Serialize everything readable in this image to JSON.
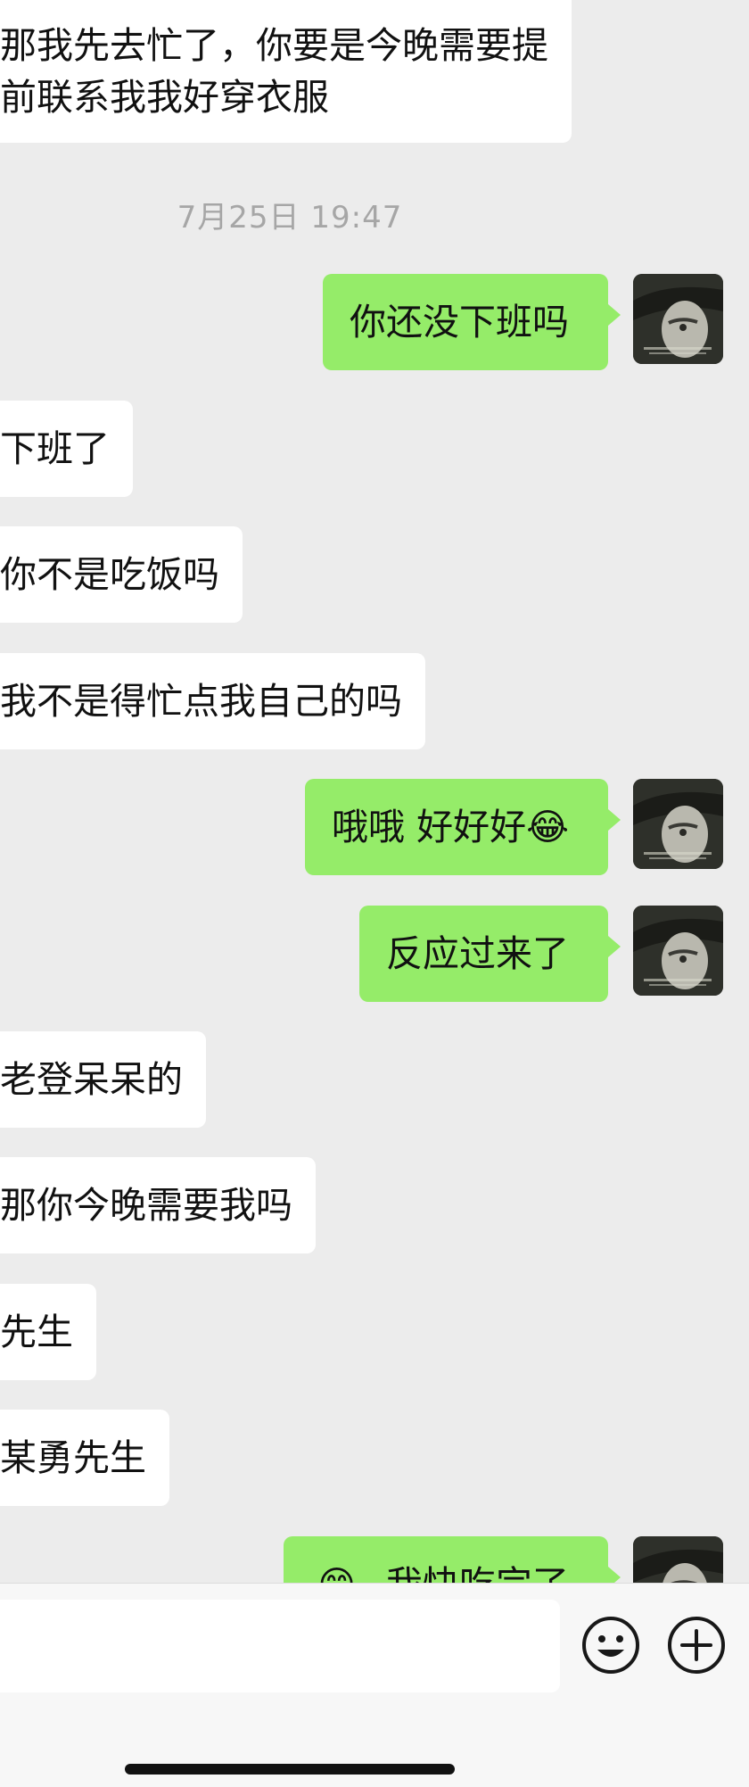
{
  "messages": [
    {
      "side": "in",
      "lines": [
        "那我先去忙了，你要是今晚需要提",
        "前联系我我好穿衣服"
      ]
    },
    {
      "side": "out",
      "text": "你还没下班吗"
    },
    {
      "side": "in",
      "text": "下班了"
    },
    {
      "side": "in",
      "text": "你不是吃饭吗"
    },
    {
      "side": "in",
      "text": "我不是得忙点我自己的吗"
    },
    {
      "side": "out",
      "text": "哦哦  好好好",
      "emoji": "😂"
    },
    {
      "side": "out",
      "text": "反应过来了"
    },
    {
      "side": "in",
      "text": "老登呆呆的"
    },
    {
      "side": "in",
      "text": "那你今晚需要我吗"
    },
    {
      "side": "in",
      "text": "先生"
    },
    {
      "side": "in",
      "text": "某勇先生"
    },
    {
      "side": "out",
      "text": "我快吃完了",
      "emoji": "😄"
    }
  ],
  "timestamp": "7月25日 19:47",
  "avatar": {
    "icon": "anime-character-avatar"
  },
  "input_bar": {
    "emoji_icon": "smiley-face-icon",
    "plus_icon": "plus-circle-icon"
  },
  "colors": {
    "background": "#ececec",
    "outgoing_bubble": "#95ec69",
    "incoming_bubble": "#ffffff",
    "timestamp": "#a6a6a6"
  }
}
